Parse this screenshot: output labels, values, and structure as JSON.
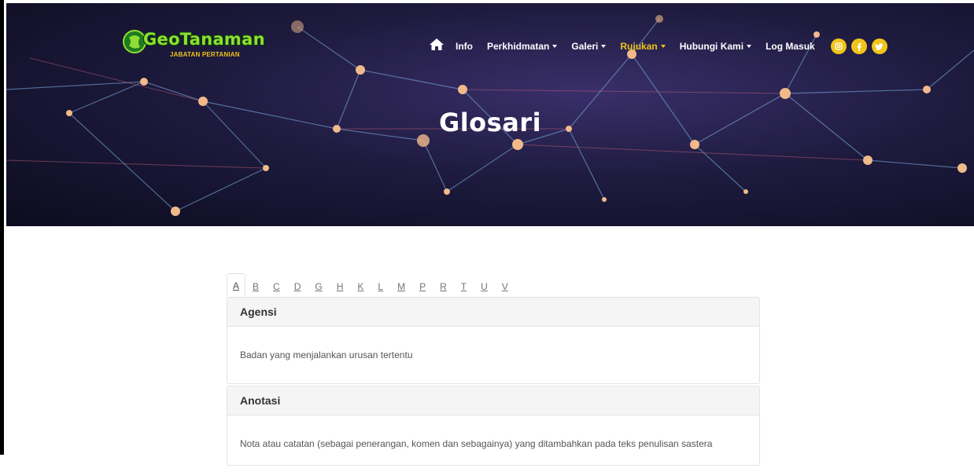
{
  "brand": {
    "name": "GeoTanaman",
    "subtitle": "JABATAN PERTANIAN"
  },
  "nav": {
    "items": [
      {
        "label": "Info",
        "dropdown": false,
        "active": false
      },
      {
        "label": "Perkhidmatan",
        "dropdown": true,
        "active": false
      },
      {
        "label": "Galeri",
        "dropdown": true,
        "active": false
      },
      {
        "label": "Rujukan",
        "dropdown": true,
        "active": true
      },
      {
        "label": "Hubungi Kami",
        "dropdown": true,
        "active": false
      },
      {
        "label": "Log Masuk",
        "dropdown": false,
        "active": false
      }
    ],
    "social_icons": [
      "instagram-icon",
      "facebook-icon",
      "twitter-icon"
    ],
    "home_icon": "home-icon"
  },
  "hero": {
    "title": "Glosari"
  },
  "glossary": {
    "letters": [
      "A",
      "B",
      "C",
      "D",
      "G",
      "H",
      "K",
      "L",
      "M",
      "P",
      "R",
      "T",
      "U",
      "V"
    ],
    "active_letter": "A",
    "entries": [
      {
        "term": "Agensi",
        "definition": "Badan yang menjalankan urusan tertentu"
      },
      {
        "term": "Anotasi",
        "definition": "Nota atau catatan (sebagai penerangan, komen dan sebagainya) yang ditambahkan pada teks penulisan sastera"
      }
    ]
  },
  "colors": {
    "accent": "#f0c419",
    "brand_green": "#8ede34",
    "hero_dark": "#1e1b3f"
  }
}
